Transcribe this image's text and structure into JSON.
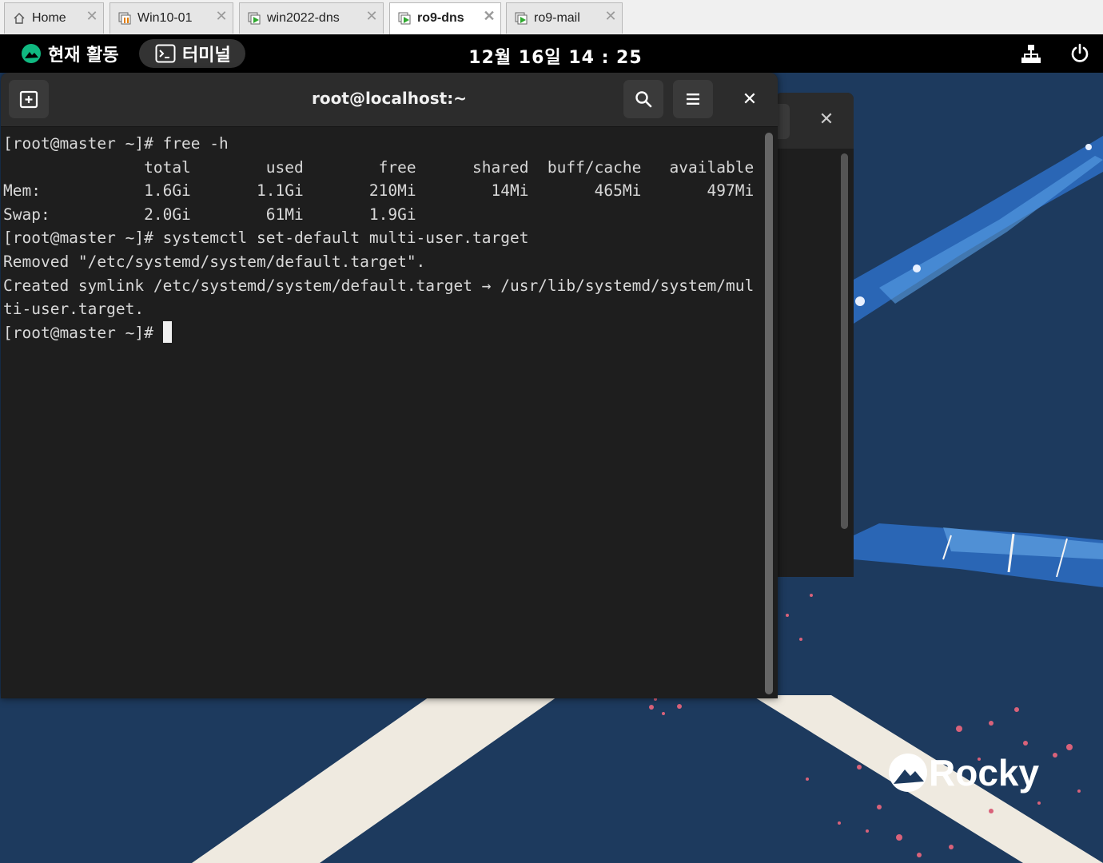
{
  "tabs": [
    {
      "label": "Home",
      "icon": "home-icon",
      "active": false
    },
    {
      "label": "Win10-01",
      "icon": "vm-paused-icon",
      "active": false
    },
    {
      "label": "win2022-dns",
      "icon": "vm-running-icon",
      "active": false
    },
    {
      "label": "ro9-dns",
      "icon": "vm-running-icon",
      "active": true
    },
    {
      "label": "ro9-mail",
      "icon": "vm-running-icon",
      "active": false
    }
  ],
  "topbar": {
    "activities_label": "현재 활동",
    "app_label": "터미널",
    "clock": "12월 16일  14 : 25"
  },
  "terminal": {
    "title": "root@localhost:~",
    "lines": [
      "[root@master ~]# free -h",
      "               total        used        free      shared  buff/cache   available",
      "Mem:           1.6Gi       1.1Gi       210Mi        14Mi       465Mi       497Mi",
      "Swap:          2.0Gi        61Mi       1.9Gi",
      "[root@master ~]# systemctl set-default multi-user.target",
      "Removed \"/etc/systemd/system/default.target\".",
      "Created symlink /etc/systemd/system/default.target → /usr/lib/systemd/system/mul",
      "ti-user.target."
    ],
    "prompt": "[root@master ~]# "
  },
  "wallpaper": {
    "brand": "Rocky"
  },
  "colors": {
    "desktop_bg": "#1d3a5e",
    "terminal_bg": "#1e1e1e",
    "header_bg": "#2c2c2c",
    "rocky_green": "#10b981"
  }
}
